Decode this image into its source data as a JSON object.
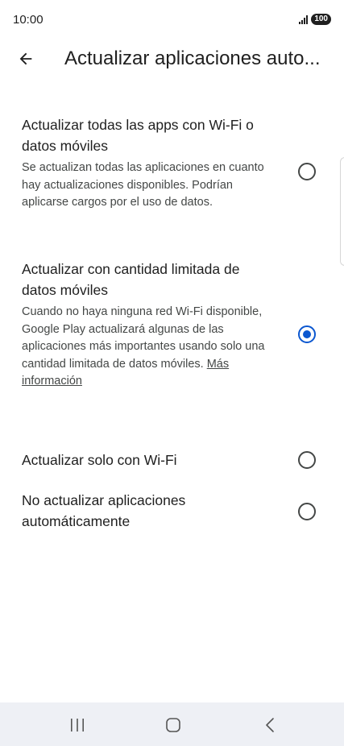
{
  "status_bar": {
    "time": "10:00",
    "battery": "100",
    "signal_icon": "signal-icon"
  },
  "app_bar": {
    "back_icon": "arrow-back-icon",
    "title": "Actualizar aplicaciones auto..."
  },
  "options": [
    {
      "title": "Actualizar todas las apps con Wi-Fi o datos móviles",
      "description": "Se actualizan todas las aplicaciones en cuanto hay actualizaciones disponibles. Podrían aplicarse cargos por el uso de datos.",
      "selected": false
    },
    {
      "title": "Actualizar con cantidad limitada de datos móviles",
      "description": "Cuando no haya ninguna red Wi-Fi disponible, Google Play actualizará algunas de las aplicaciones más importantes usando solo una cantidad limitada de datos móviles.",
      "link": "Más información",
      "selected": true
    },
    {
      "title": "Actualizar solo con Wi-Fi",
      "selected": false
    },
    {
      "title": "No actualizar aplicaciones automáticamente",
      "selected": false
    }
  ],
  "nav_bar": {
    "recents_icon": "recents-icon",
    "home_icon": "home-icon",
    "back_icon": "back-chevron-icon"
  },
  "colors": {
    "accent": "#0b57d0",
    "text_primary": "#1f1f1f",
    "text_secondary": "#444746",
    "nav_background": "#eef0f5"
  }
}
